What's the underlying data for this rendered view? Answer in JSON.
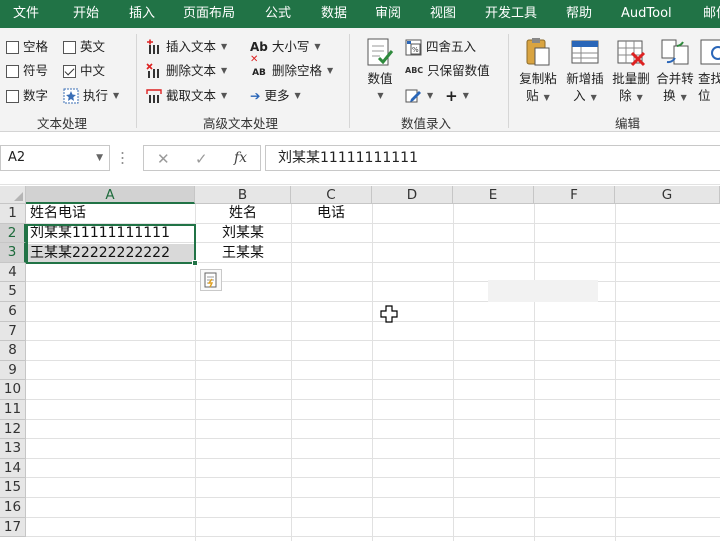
{
  "ribbon_tabs": [
    "文件",
    "开始",
    "插入",
    "页面布局",
    "公式",
    "数据",
    "审阅",
    "视图",
    "开发工具",
    "帮助",
    "AudTool",
    "邮件"
  ],
  "groups": {
    "text_processing": {
      "label": "文本处理",
      "items": [
        {
          "label": "空格",
          "checked": false
        },
        {
          "label": "英文",
          "checked": false
        },
        {
          "label": "符号",
          "checked": false
        },
        {
          "label": "中文",
          "checked": true
        },
        {
          "label": "数字",
          "checked": false
        }
      ],
      "execute_label": "执行"
    },
    "advanced_text": {
      "label": "高级文本处理",
      "insert_text": "插入文本",
      "delete_text": "删除文本",
      "extract_text": "截取文本",
      "case_label": "大小写",
      "case_icon_text": "Ab",
      "delete_spaces": "删除空格",
      "delete_spaces_icon_text": "AB",
      "more": "更多"
    },
    "number_entry": {
      "label": "数值录入",
      "numeric": "数值",
      "round": "四舍五入",
      "keep_value": "只保留数值",
      "keep_value_icon_text": "ABC"
    },
    "edit": {
      "label": "编辑",
      "copy_paste": [
        "复制粘",
        "贴"
      ],
      "new_insert": [
        "新增插",
        "入"
      ],
      "batch_delete": [
        "批量删",
        "除"
      ],
      "merge_convert": [
        "合并转",
        "换"
      ],
      "find_locate": [
        "查找",
        "位"
      ]
    }
  },
  "name_box": "A2",
  "fx_label": "fx",
  "formula_value": "刘某某11111111111",
  "columns": [
    "A",
    "B",
    "C",
    "D",
    "E",
    "F",
    "G"
  ],
  "rows": [
    "1",
    "2",
    "3",
    "4",
    "5",
    "6",
    "7",
    "8",
    "9",
    "10",
    "11",
    "12",
    "13",
    "14",
    "15",
    "16",
    "17"
  ],
  "cells": {
    "A1": "姓名电话",
    "B1": "姓名",
    "C1": "电话",
    "A2": "刘某某11111111111",
    "B2": "刘某某",
    "A3": "王某某22222222222",
    "B3": "王某某"
  },
  "selection": "A2:A3",
  "colors": {
    "ribbon_green": "#217346",
    "ribbon_bg": "#f3f3f3",
    "header_bg": "#e6e6e6",
    "selection_fill": "#d9d9d9"
  }
}
